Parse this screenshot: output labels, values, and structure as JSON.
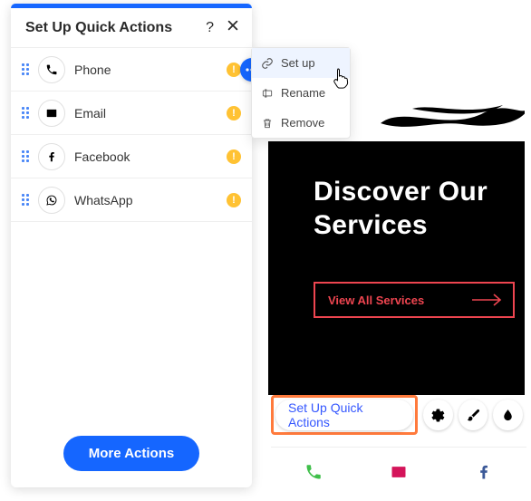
{
  "panel": {
    "title": "Set Up Quick Actions",
    "rows": [
      {
        "label": "Phone",
        "icon": "phone"
      },
      {
        "label": "Email",
        "icon": "email"
      },
      {
        "label": "Facebook",
        "icon": "facebook"
      },
      {
        "label": "WhatsApp",
        "icon": "whatsapp"
      }
    ],
    "more_actions": "More Actions"
  },
  "context_menu": {
    "setup": "Set up",
    "rename": "Rename",
    "remove": "Remove"
  },
  "preview": {
    "heading_line1": "Discover Our",
    "heading_line2": "Services",
    "view_all": "View All Services",
    "toolbar_pill": "Set Up Quick Actions"
  }
}
